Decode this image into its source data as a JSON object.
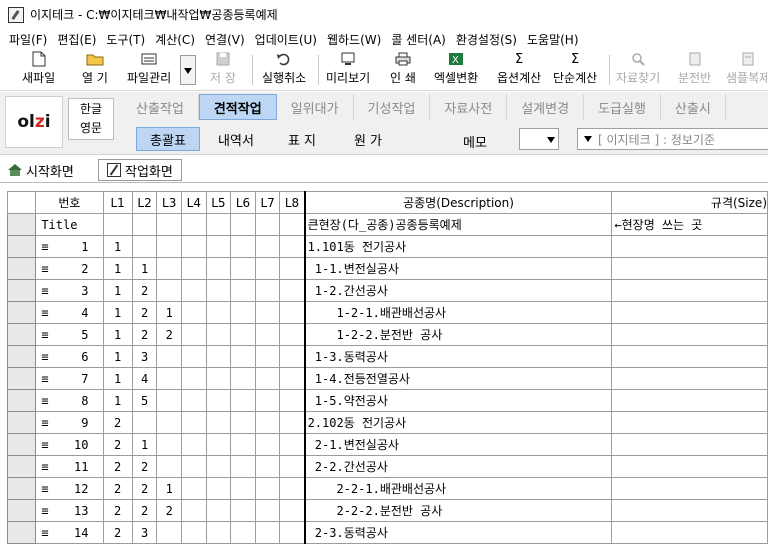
{
  "window": {
    "title": "이지테크 - C:₩이지테크₩내작업₩공종등록예제"
  },
  "menu": [
    "파일(F)",
    "편집(E)",
    "도구(T)",
    "계산(C)",
    "연결(V)",
    "업데이트(U)",
    "웹하드(W)",
    "콜 센터(A)",
    "환경설정(S)",
    "도움말(H)"
  ],
  "toolbar": {
    "new_file": "새파일",
    "open": "열 기",
    "file_manage": "파일관리",
    "save": "저 장",
    "undo": "실행취소",
    "preview": "미리보기",
    "print": "인 쇄",
    "excel": "엑셀변환",
    "option_calc": "옵션계산",
    "simple_calc": "단순계산",
    "find_data": "자료찾기",
    "panel": "분전반",
    "sample_copy": "샘플복제"
  },
  "logo": {
    "text": "olzi"
  },
  "lang": {
    "korean": "한글",
    "english": "영문"
  },
  "main_tabs": [
    "산출작업",
    "견적작업",
    "일위대가",
    "기성작업",
    "자료사전",
    "설계변경",
    "도급실행",
    "산출시"
  ],
  "sub_tabs": [
    "총괄표",
    "내역서",
    "표 지",
    "원 가"
  ],
  "memo": {
    "label": "메모"
  },
  "standard": {
    "value": "[ 이지테크 ] : 정보기준"
  },
  "doc_tabs": {
    "home": "시작화면",
    "work": "작업화면"
  },
  "grid": {
    "headers": [
      "번호",
      "L1",
      "L2",
      "L3",
      "L4",
      "L5",
      "L6",
      "L7",
      "L8",
      "공종명(Description)",
      "규격(Size)"
    ],
    "eq_mark": "≡",
    "rows": [
      {
        "num": "Title",
        "eq": "",
        "l1": "",
        "l2": "",
        "l3": "",
        "name": "큰현장(다_공종)공종등록예제",
        "size": "←현장명 쓰는 곳"
      },
      {
        "num": "1",
        "eq": "≡",
        "l1": "1",
        "l2": "",
        "l3": "",
        "name": "1.101동 전기공사",
        "size": ""
      },
      {
        "num": "2",
        "eq": "≡",
        "l1": "1",
        "l2": "1",
        "l3": "",
        "name": " 1-1.변전실공사",
        "size": ""
      },
      {
        "num": "3",
        "eq": "≡",
        "l1": "1",
        "l2": "2",
        "l3": "",
        "name": " 1-2.간선공사",
        "size": ""
      },
      {
        "num": "4",
        "eq": "≡",
        "l1": "1",
        "l2": "2",
        "l3": "1",
        "name": "    1-2-1.배관배선공사",
        "size": ""
      },
      {
        "num": "5",
        "eq": "≡",
        "l1": "1",
        "l2": "2",
        "l3": "2",
        "name": "    1-2-2.분전반 공사",
        "size": ""
      },
      {
        "num": "6",
        "eq": "≡",
        "l1": "1",
        "l2": "3",
        "l3": "",
        "name": " 1-3.동력공사",
        "size": ""
      },
      {
        "num": "7",
        "eq": "≡",
        "l1": "1",
        "l2": "4",
        "l3": "",
        "name": " 1-4.전등전열공사",
        "size": ""
      },
      {
        "num": "8",
        "eq": "≡",
        "l1": "1",
        "l2": "5",
        "l3": "",
        "name": " 1-5.약전공사",
        "size": ""
      },
      {
        "num": "9",
        "eq": "≡",
        "l1": "2",
        "l2": "",
        "l3": "",
        "name": "2.102동 전기공사",
        "size": ""
      },
      {
        "num": "10",
        "eq": "≡",
        "l1": "2",
        "l2": "1",
        "l3": "",
        "name": " 2-1.변전실공사",
        "size": ""
      },
      {
        "num": "11",
        "eq": "≡",
        "l1": "2",
        "l2": "2",
        "l3": "",
        "name": " 2-2.간선공사",
        "size": ""
      },
      {
        "num": "12",
        "eq": "≡",
        "l1": "2",
        "l2": "2",
        "l3": "1",
        "name": "    2-2-1.배관배선공사",
        "size": ""
      },
      {
        "num": "13",
        "eq": "≡",
        "l1": "2",
        "l2": "2",
        "l3": "2",
        "name": "    2-2-2.분전반 공사",
        "size": ""
      },
      {
        "num": "14",
        "eq": "≡",
        "l1": "2",
        "l2": "3",
        "l3": "",
        "name": " 2-3.동력공사",
        "size": ""
      }
    ]
  },
  "colors": {
    "active_tab": "#bcd6f3",
    "logo_accent": "#d1281f"
  }
}
